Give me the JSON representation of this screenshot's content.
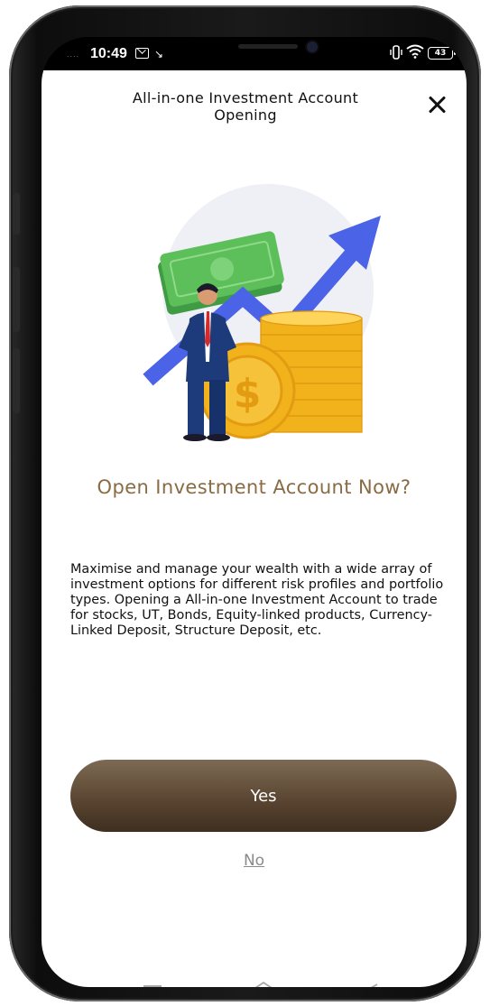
{
  "status_bar": {
    "time": "10:49",
    "signal": "....",
    "battery": "43",
    "nav_arrow": "↘",
    "vibrate_icon": "⍬",
    "wifi_icon": "≋"
  },
  "header": {
    "title": "All-in-one Investment Account Opening",
    "close_icon": "close-icon"
  },
  "hero": {
    "icon": "investment-growth-illustration",
    "colors": {
      "arrow": "#4b63e6",
      "coin": "#f2b21b",
      "cash": "#4caf50",
      "suit": "#1d3b7a",
      "circle": "#eef0f6"
    }
  },
  "content": {
    "headline": "Open Investment Account Now?",
    "body": "Maximise and manage your wealth with a wide array of investment options for different risk profiles and portfolio types. Opening a All-in-one Investment Account to trade for stocks, UT, Bonds, Equity-linked products, Currency-Linked Deposit, Structure Deposit, etc."
  },
  "actions": {
    "yes_label": "Yes",
    "no_label": "No"
  },
  "system_nav": {
    "menu_icon": "menu-icon",
    "home_icon": "home-icon",
    "back_icon": "back-icon"
  },
  "colors": {
    "accent": "#8a6b43",
    "button": "#57432f"
  }
}
